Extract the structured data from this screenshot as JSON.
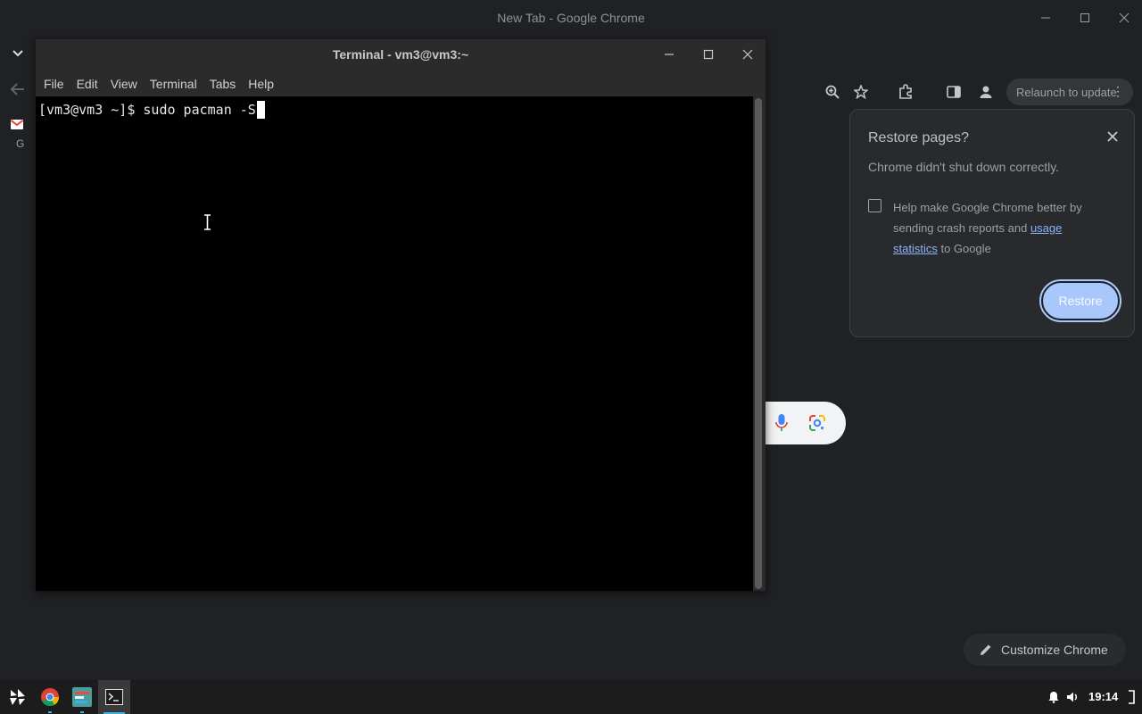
{
  "chrome": {
    "window_title": "New Tab - Google Chrome",
    "bookmark_label": "G",
    "relaunch_label": "Relaunch to update",
    "restore_popup": {
      "title": "Restore pages?",
      "subtitle": "Chrome didn't shut down correctly.",
      "checkbox_checked": false,
      "text_before_link": "Help make Google Chrome better by sending crash reports and ",
      "link_text": "usage statistics",
      "text_after_link": " to Google",
      "restore_button": "Restore"
    },
    "customize_label": "Customize Chrome"
  },
  "terminal": {
    "title": "Terminal - vm3@vm3:~",
    "menu": [
      "File",
      "Edit",
      "View",
      "Terminal",
      "Tabs",
      "Help"
    ],
    "prompt": "[vm3@vm3 ~]$ ",
    "command": "sudo pacman -S"
  },
  "taskbar": {
    "clock": "19:14",
    "items": [
      "app-launcher-icon",
      "chrome-icon",
      "system-settings-icon",
      "terminal-icon"
    ]
  },
  "colors": {
    "chrome_bg": "#202124",
    "popup_bg": "#292a2d",
    "link": "#8ab4f8",
    "restore_button": "#a8c7fa",
    "terminal_bg": "#000000",
    "taskbar_bg": "#1c1c1c",
    "active_indicator": "#3daee9"
  }
}
